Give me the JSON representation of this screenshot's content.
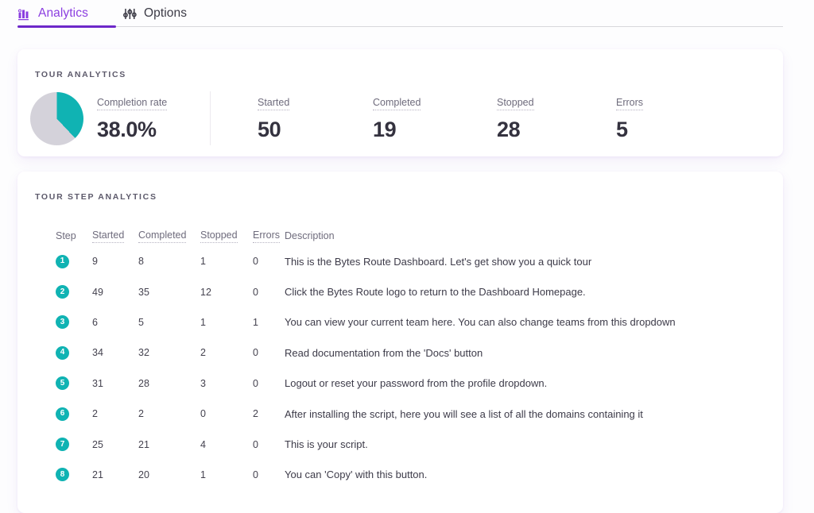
{
  "tabs": [
    {
      "label": "Analytics",
      "icon": "bar-chart-icon",
      "active": true
    },
    {
      "label": "Options",
      "icon": "sliders-icon",
      "active": false
    }
  ],
  "colors": {
    "accent_purple": "#6d28c9",
    "tab_active_text": "#8b3ee0",
    "teal": "#10b3b3",
    "pie_remainder_gray": "#d4d2da"
  },
  "analytics_card": {
    "title": "TOUR ANALYTICS",
    "completion": {
      "label": "Completion rate",
      "value": "38.0%"
    },
    "stats": [
      {
        "label": "Started",
        "value": "50"
      },
      {
        "label": "Completed",
        "value": "19"
      },
      {
        "label": "Stopped",
        "value": "28"
      },
      {
        "label": "Errors",
        "value": "5"
      }
    ]
  },
  "steps_card": {
    "title": "TOUR STEP ANALYTICS",
    "columns": {
      "step": "Step",
      "started": "Started",
      "completed": "Completed",
      "stopped": "Stopped",
      "errors": "Errors",
      "description": "Description"
    },
    "rows": [
      {
        "step": "1",
        "started": "9",
        "completed": "8",
        "stopped": "1",
        "errors": "0",
        "description": "This is the Bytes Route Dashboard. Let's get show you a quick tour"
      },
      {
        "step": "2",
        "started": "49",
        "completed": "35",
        "stopped": "12",
        "errors": "0",
        "description": "Click the Bytes Route logo to return to the Dashboard Homepage."
      },
      {
        "step": "3",
        "started": "6",
        "completed": "5",
        "stopped": "1",
        "errors": "1",
        "description": "You can view your current team here. You can also change teams from this dropdown"
      },
      {
        "step": "4",
        "started": "34",
        "completed": "32",
        "stopped": "2",
        "errors": "0",
        "description": "Read documentation from the 'Docs' button"
      },
      {
        "step": "5",
        "started": "31",
        "completed": "28",
        "stopped": "3",
        "errors": "0",
        "description": "Logout or reset your password from the profile dropdown."
      },
      {
        "step": "6",
        "started": "2",
        "completed": "2",
        "stopped": "0",
        "errors": "2",
        "description": "After installing the script, here you will see a list of all the domains containing it"
      },
      {
        "step": "7",
        "started": "25",
        "completed": "21",
        "stopped": "4",
        "errors": "0",
        "description": "This is your script."
      },
      {
        "step": "8",
        "started": "21",
        "completed": "20",
        "stopped": "1",
        "errors": "0",
        "description": "You can 'Copy' with this button."
      }
    ]
  },
  "chart_data": {
    "type": "pie",
    "title": "Completion rate",
    "categories": [
      "Completed",
      "Not completed"
    ],
    "values": [
      38.0,
      62.0
    ],
    "colors": [
      "#10b3b3",
      "#d4d2da"
    ],
    "start_angle_deg": 0,
    "legend": "none",
    "data_label": "38.0%"
  }
}
